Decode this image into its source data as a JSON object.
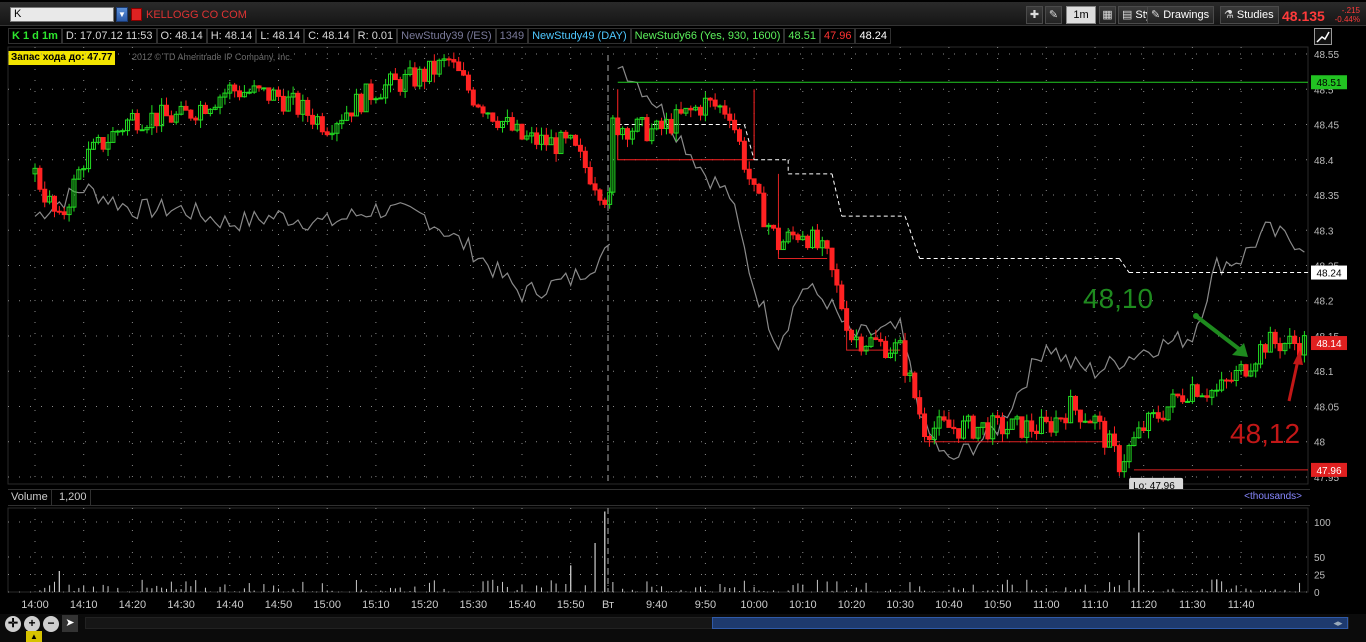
{
  "toolbar": {
    "symbol": "K",
    "company": "KELLOGG CO COM",
    "timeframe": "1m",
    "style_label": "Style",
    "drawings_label": "Drawings",
    "studies_label": "Studies",
    "last_price": "48.135",
    "net_change": "-.215",
    "pct_change": "-0.44%"
  },
  "infobar": {
    "symbol_period": "K 1 d 1m",
    "date": "D: 17.07.12 11:53",
    "open": "O: 48.14",
    "high": "H: 48.14",
    "low": "L: 48.14",
    "close": "C: 48.14",
    "range": "R: 0.01",
    "study39": "NewStudy39 (/ES)",
    "study39_value": "1349",
    "study49": "NewStudy49 (DAY)",
    "study66": "NewStudy66 (Yes, 930, 1600)",
    "study66_high": "48.51",
    "study66_low": "47.96",
    "study66_mid": "48.24"
  },
  "zapas_label": "Запас хода до: 47.77",
  "copyright": "2012 © TD Ameritrade IP Company, Inc.",
  "annotations": {
    "green_note": "48,10",
    "red_note": "48,12"
  },
  "volume_panel": {
    "title": "Volume",
    "value": "1,200",
    "units": "<thousands>"
  },
  "colors": {
    "up": "#22dd22",
    "down": "#ff2222",
    "overlay": "#8a8a8a",
    "level_green": "#22cc22",
    "level_red": "#dd2222",
    "dashed": "#ffffff",
    "grid": "#8a8a8a",
    "volume": "#c8c8c8"
  },
  "chart_data": {
    "type": "candlestick",
    "title": "",
    "ylim": [
      47.94,
      48.56
    ],
    "y_ticks": [
      "48.55",
      "48.5",
      "48.45",
      "48.4",
      "48.35",
      "48.3",
      "48.25",
      "48.2",
      "48.15",
      "48.1",
      "48.05",
      "48",
      "47.95"
    ],
    "x_ticks": [
      "14:00",
      "14:10",
      "14:20",
      "14:30",
      "14:40",
      "14:50",
      "15:00",
      "15:10",
      "15:20",
      "15:30",
      "15:40",
      "15:50",
      "Вт",
      "9:40",
      "9:50",
      "10:00",
      "10:10",
      "10:20",
      "10:30",
      "10:40",
      "10:50",
      "11:00",
      "11:10",
      "11:20",
      "11:30",
      "11:40"
    ],
    "session_break": "Вт",
    "key_points": [
      {
        "time": "14:00",
        "price": 48.38
      },
      {
        "time": "14:05",
        "price": 48.31
      },
      {
        "time": "14:10",
        "price": 48.4
      },
      {
        "time": "14:20",
        "price": 48.46
      },
      {
        "time": "14:30",
        "price": 48.46
      },
      {
        "time": "14:40",
        "price": 48.5
      },
      {
        "time": "14:50",
        "price": 48.49
      },
      {
        "time": "15:00",
        "price": 48.45
      },
      {
        "time": "15:10",
        "price": 48.5
      },
      {
        "time": "15:20",
        "price": 48.52
      },
      {
        "time": "15:25",
        "price": 48.54
      },
      {
        "time": "15:30",
        "price": 48.49
      },
      {
        "time": "15:40",
        "price": 48.43
      },
      {
        "time": "15:50",
        "price": 48.42
      },
      {
        "time": "15:58",
        "price": 48.34
      },
      {
        "time": "9:31",
        "price": 48.45
      },
      {
        "time": "9:40",
        "price": 48.44
      },
      {
        "time": "9:50",
        "price": 48.48
      },
      {
        "time": "9:55",
        "price": 48.47
      },
      {
        "time": "10:00",
        "price": 48.35
      },
      {
        "time": "10:05",
        "price": 48.28
      },
      {
        "time": "10:10",
        "price": 48.3
      },
      {
        "time": "10:15",
        "price": 48.26
      },
      {
        "time": "10:20",
        "price": 48.15
      },
      {
        "time": "10:30",
        "price": 48.13
      },
      {
        "time": "10:35",
        "price": 48.02
      },
      {
        "time": "10:40",
        "price": 48.02
      },
      {
        "time": "10:50",
        "price": 48.02
      },
      {
        "time": "11:00",
        "price": 48.02
      },
      {
        "time": "11:05",
        "price": 48.05
      },
      {
        "time": "11:10",
        "price": 48.03
      },
      {
        "time": "11:15",
        "price": 47.97
      },
      {
        "time": "11:20",
        "price": 48.02
      },
      {
        "time": "11:30",
        "price": 48.08
      },
      {
        "time": "11:35",
        "price": 48.07
      },
      {
        "time": "11:40",
        "price": 48.1
      },
      {
        "time": "11:45",
        "price": 48.14
      },
      {
        "time": "11:53",
        "price": 48.14
      }
    ],
    "overlay_series": {
      "points": [
        {
          "time": "14:00",
          "value": 48.32
        },
        {
          "time": "14:10",
          "value": 48.36
        },
        {
          "time": "14:20",
          "value": 48.33
        },
        {
          "time": "14:30",
          "value": 48.33
        },
        {
          "time": "14:40",
          "value": 48.31
        },
        {
          "time": "14:50",
          "value": 48.32
        },
        {
          "time": "15:00",
          "value": 48.31
        },
        {
          "time": "15:10",
          "value": 48.33
        },
        {
          "time": "15:20",
          "value": 48.32
        },
        {
          "time": "15:30",
          "value": 48.27
        },
        {
          "time": "15:40",
          "value": 48.21
        },
        {
          "time": "15:50",
          "value": 48.23
        },
        {
          "time": "15:58",
          "value": 48.27
        },
        {
          "time": "9:32",
          "value": 48.54
        },
        {
          "time": "9:40",
          "value": 48.48
        },
        {
          "time": "9:50",
          "value": 48.38
        },
        {
          "time": "9:55",
          "value": 48.35
        },
        {
          "time": "10:00",
          "value": 48.22
        },
        {
          "time": "10:05",
          "value": 48.14
        },
        {
          "time": "10:10",
          "value": 48.22
        },
        {
          "time": "10:15",
          "value": 48.2
        },
        {
          "time": "10:20",
          "value": 48.15
        },
        {
          "time": "10:30",
          "value": 48.16
        },
        {
          "time": "10:35",
          "value": 48.02
        },
        {
          "time": "10:40",
          "value": 47.97
        },
        {
          "time": "10:50",
          "value": 48.02
        },
        {
          "time": "11:00",
          "value": 48.14
        },
        {
          "time": "11:05",
          "value": 48.11
        },
        {
          "time": "11:10",
          "value": 48.1
        },
        {
          "time": "11:20",
          "value": 48.13
        },
        {
          "time": "11:30",
          "value": 48.15
        },
        {
          "time": "11:35",
          "value": 48.25
        },
        {
          "time": "11:40",
          "value": 48.26
        },
        {
          "time": "11:45",
          "value": 48.3
        },
        {
          "time": "11:53",
          "value": 48.28
        }
      ]
    },
    "levels": {
      "opening_range_high": 48.51,
      "opening_range_low": 47.96,
      "midline": 48.24,
      "last": 48.14,
      "session_low_label": "Lo: 47.96"
    },
    "stair_box": [
      {
        "from": "9:32",
        "to": "10:00",
        "high": 48.5,
        "low": 48.4
      },
      {
        "from": "10:05",
        "to": "10:15",
        "high": 48.38,
        "low": 48.26
      },
      {
        "from": "10:19",
        "to": "10:30",
        "high": 48.2,
        "low": 48.13
      },
      {
        "from": "10:35",
        "to": "11:15",
        "high": 48.04,
        "low": 48.0
      }
    ],
    "dashed_level_steps": [
      {
        "from": "9:32",
        "to": "9:58",
        "value": 48.45
      },
      {
        "from": "10:00",
        "to": "10:07",
        "value": 48.4
      },
      {
        "from": "10:07",
        "to": "10:16",
        "value": 48.38
      },
      {
        "from": "10:18",
        "to": "10:31",
        "value": 48.32
      },
      {
        "from": "10:34",
        "to": "11:15",
        "value": 48.26
      },
      {
        "from": "11:17",
        "to": "11:55",
        "value": 48.24
      }
    ],
    "axis_labels": [
      {
        "text": "48.51",
        "price": 48.51,
        "style": "green"
      },
      {
        "text": "48.24",
        "price": 48.24,
        "style": "white"
      },
      {
        "text": "48.14",
        "price": 48.14,
        "style": "red"
      },
      {
        "text": "47.96",
        "price": 47.96,
        "style": "red"
      }
    ],
    "volume": {
      "ylim": [
        0,
        120
      ],
      "y_ticks": [
        "100",
        "50",
        "25",
        "0"
      ],
      "spikes": [
        {
          "time": "15:57",
          "value": 115
        },
        {
          "time": "15:55",
          "value": 70
        },
        {
          "time": "15:50",
          "value": 38
        },
        {
          "time": "11:19",
          "value": 85
        },
        {
          "time": "14:05",
          "value": 30
        },
        {
          "time": "11:35",
          "value": 18
        }
      ]
    }
  }
}
